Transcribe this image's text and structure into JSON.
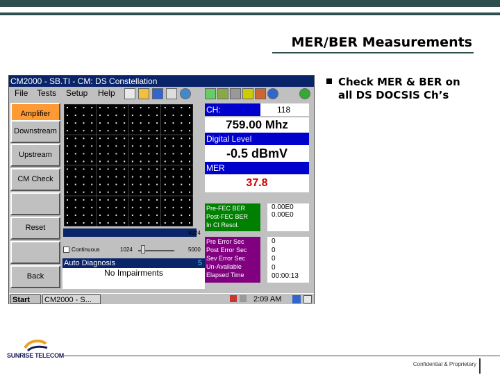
{
  "slide": {
    "title": "MER/BER Measurements",
    "bullet": "Check MER & BER on all DS DOCSIS Ch’s",
    "logo_text": "SUNRISE TELECOM",
    "footer": "Confidential & Proprietary"
  },
  "app": {
    "window_title": "CM2000 - SB.TI - CM: DS Constellation",
    "menu": [
      "File",
      "Tests",
      "Setup",
      "Help"
    ],
    "side_buttons": [
      "Amplifier",
      "Downstream",
      "Upstream",
      "CM Check",
      "",
      "Reset",
      "",
      "Back"
    ],
    "axis_right": "4024",
    "continuous_label": "Continuous",
    "slider_min": "1024",
    "slider_max": "5000",
    "auto_diagnosis": "Auto Diagnosis",
    "auto_diagnosis_extra": "5",
    "diagnosis_result": "No Impairments",
    "ch_label": "CH:",
    "ch_value": "118",
    "frequency": "759.00 Mhz",
    "digital_level_label": "Digital Level",
    "digital_level_value": "-0.5 dBmV",
    "mer_label": "MER",
    "mer_value": "37.8",
    "ber_labels": [
      "Pre-FEC BER",
      "Post-FEC BER",
      "In CI Resol."
    ],
    "ber_values": [
      "0.00E0",
      "0.00E0",
      ""
    ],
    "err_labels": [
      "Pre Error Sec",
      "Post Error Sec",
      "Sev Error Sec",
      "Un-Available",
      "Elapsed Time"
    ],
    "err_values": [
      "0",
      "0",
      "0",
      "0",
      "00:00:13"
    ],
    "taskbar_start": "Start",
    "taskbar_task": "CM2000 - S...",
    "taskbar_time": "2:09 AM"
  },
  "colors": {
    "accent_orange": "#ff9933",
    "mer_value": "#cc0000",
    "ber_panel": "#008000",
    "err_panel": "#800080",
    "header_blue": "#0000cc"
  }
}
